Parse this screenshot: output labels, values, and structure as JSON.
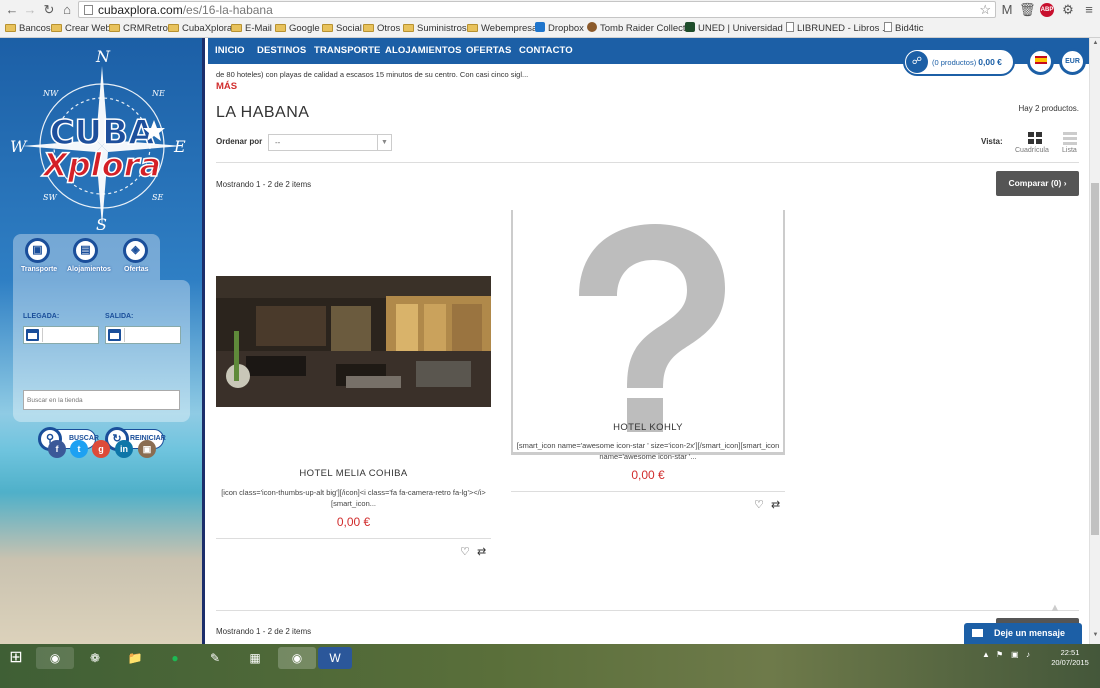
{
  "browser": {
    "url_host": "cubaxplora.com",
    "url_path": "/es/16-la-habana",
    "bookmarks": [
      {
        "label": "Bancos",
        "kind": "folder"
      },
      {
        "label": "Crear Web",
        "kind": "folder"
      },
      {
        "label": "CRMRetro",
        "kind": "folder"
      },
      {
        "label": "CubaXplora",
        "kind": "folder"
      },
      {
        "label": "E-Mail",
        "kind": "folder"
      },
      {
        "label": "Google",
        "kind": "folder"
      },
      {
        "label": "Social",
        "kind": "folder"
      },
      {
        "label": "Otros",
        "kind": "folder"
      },
      {
        "label": "Suministros",
        "kind": "folder"
      },
      {
        "label": "Webempresa",
        "kind": "folder"
      },
      {
        "label": "Dropbox",
        "kind": "dropbox"
      },
      {
        "label": "Tomb Raider Collect...",
        "kind": "fav"
      },
      {
        "label": "UNED | Universidad ...",
        "kind": "uned"
      },
      {
        "label": "LIBRUNED - Libros ...",
        "kind": "page"
      },
      {
        "label": "Bid4tic",
        "kind": "page"
      }
    ],
    "abp_label": "ABP"
  },
  "sidebar": {
    "quick_links": [
      "Transporte",
      "Alojamientos",
      "Ofertas"
    ],
    "arrival_label": "LLEGADA:",
    "departure_label": "SALIDA:",
    "search_placeholder": "Buscar en la tienda",
    "search_button": "BUSCAR",
    "reset_button": "REINICIAR",
    "logo_line1": "CUBA",
    "logo_line2": "Xplora"
  },
  "nav": {
    "items": [
      "INICIO",
      "DESTINOS",
      "TRANSPORTE",
      "ALOJAMIENTOS",
      "OFERTAS",
      "CONTACTO"
    ]
  },
  "cart": {
    "count_label": "(0 productos)",
    "total": "0,00 €"
  },
  "currency": "EUR",
  "category": {
    "description": "de 80 hoteles) con playas de calidad a escasos 15 minutos de su centro. Con casi cinco sigl...",
    "more_link": "MÁS",
    "title": "LA HABANA",
    "product_count": "Hay 2 productos.",
    "sort_label": "Ordenar por",
    "sort_value": "--",
    "view_label": "Vista:",
    "view_grid": "Cuadrícula",
    "view_list": "Lista",
    "showing_top": "Mostrando 1 - 2 de 2 items",
    "showing_bottom": "Mostrando 1 - 2 de 2 items",
    "compare_button": "Comparar (0)"
  },
  "products": [
    {
      "name": "HOTEL MELIA COHIBA",
      "description": "[icon class='icon-thumbs-up-alt big'][/icon]<i class='fa fa-camera-retro fa-lg'></i>[smart_icon...",
      "price": "0,00 €"
    },
    {
      "name": "HOTEL KOHLY",
      "description": "[smart_icon name='awesome icon-star ' size='icon-2x'][/smart_icon][smart_icon name='awesome icon-star '...",
      "price": "0,00 €"
    }
  ],
  "chat": {
    "label": "Deje un mensaje"
  },
  "taskbar": {
    "time": "22:51",
    "date": "20/07/2015"
  },
  "colors": {
    "brand_blue": "#1c5fa6",
    "price_red": "#d12d2d",
    "logo_red": "#d42027"
  }
}
